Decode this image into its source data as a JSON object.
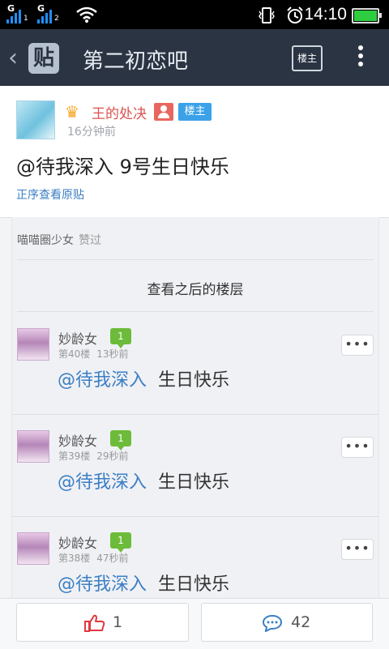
{
  "status_bar": {
    "sim1_label": "G",
    "sim1_index": "1",
    "sim2_label": "G",
    "sim2_index": "2",
    "time": "14:10",
    "icons": [
      "signal-icon",
      "signal-icon",
      "wifi-icon",
      "vibrate-icon",
      "alarm-icon",
      "battery-icon"
    ],
    "battery_level": 1.0,
    "battery_color": "#2ecc40"
  },
  "header": {
    "back_icon": "chevron-left-icon",
    "logo_text": "贴",
    "title": "第二初恋吧",
    "owner_button": "楼主",
    "menu_icon": "more-vertical-icon",
    "background": "#2b3443"
  },
  "main_post": {
    "username": "王的处决",
    "owner_badge": "楼主",
    "time": "16分钟前",
    "content": "@待我深入 9号生日快乐",
    "view_original": "正序查看原贴"
  },
  "likes_section": {
    "liker": "喵喵圈少女",
    "liked_label": "赞过"
  },
  "view_later_label": "查看之后的楼层",
  "replies": [
    {
      "username": "妙龄女",
      "level": "1",
      "floor": "第40楼",
      "time": "13秒前",
      "mention": "@待我深入",
      "text": "生日快乐"
    },
    {
      "username": "妙龄女",
      "level": "1",
      "floor": "第39楼",
      "time": "29秒前",
      "mention": "@待我深入",
      "text": "生日快乐"
    },
    {
      "username": "妙龄女",
      "level": "1",
      "floor": "第38楼",
      "time": "47秒前",
      "mention": "@待我深入",
      "text": "生日快乐"
    }
  ],
  "bottom_bar": {
    "like_count": "1",
    "comment_count": "42",
    "like_icon": "thumbs-up-icon",
    "comment_icon": "comment-icon"
  },
  "colors": {
    "accent_blue": "#3b7fc4",
    "username_red": "#d9534f",
    "badge_blue": "#3ba1e8",
    "level_green": "#6dbb3a"
  }
}
